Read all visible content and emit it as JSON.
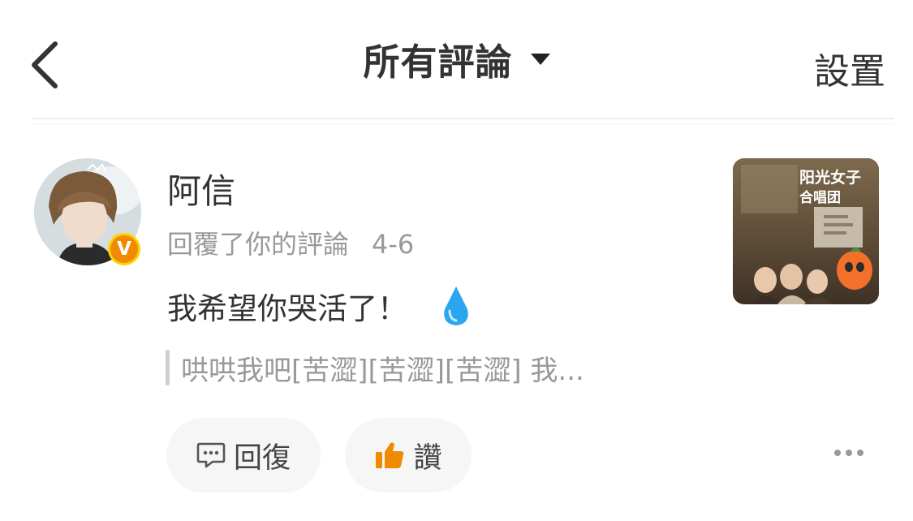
{
  "header": {
    "title": "所有評論",
    "settings_label": "設置"
  },
  "comment": {
    "username": "阿信",
    "action": "回覆了你的評論",
    "date": "4-6",
    "text": "我希望你哭活了！",
    "quoted": "哄哄我吧[苦澀][苦澀][苦澀] 我...",
    "avatar_badge": "V",
    "thumbnail_title": "阳光女子合唱团"
  },
  "actions": {
    "reply_label": "回復",
    "like_label": "讚"
  },
  "icons": {
    "back": "chevron-left-icon",
    "dropdown": "caret-down-icon",
    "verified": "verified-badge-icon",
    "emoji": "sweat-drop-icon",
    "reply": "comment-bubble-icon",
    "like": "thumbs-up-icon",
    "more": "more-dots-icon"
  },
  "colors": {
    "badge": "#f08a00",
    "badge_ring": "#ffd200",
    "like_icon": "#f08a00",
    "emoji": "#2aa6f0"
  }
}
